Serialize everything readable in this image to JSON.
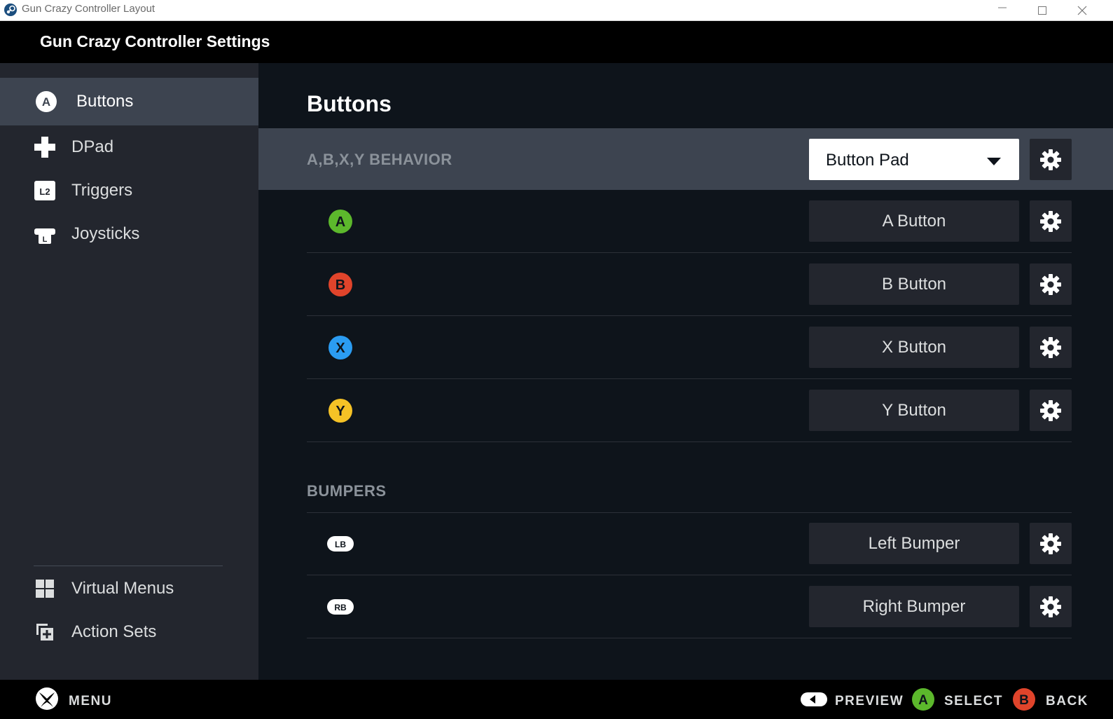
{
  "window": {
    "title": "Gun Crazy Controller Layout"
  },
  "app": {
    "title": "Gun Crazy Controller Settings"
  },
  "sidebar": {
    "items": [
      {
        "label": "Buttons",
        "icon": "a-button-icon",
        "active": true
      },
      {
        "label": "DPad",
        "icon": "dpad-icon",
        "active": false
      },
      {
        "label": "Triggers",
        "icon": "l2-trigger-icon",
        "active": false
      },
      {
        "label": "Joysticks",
        "icon": "joystick-icon",
        "active": false
      }
    ],
    "bottom_items": [
      {
        "label": "Virtual Menus",
        "icon": "virtual-menus-icon"
      },
      {
        "label": "Action Sets",
        "icon": "action-sets-icon"
      }
    ]
  },
  "main": {
    "heading": "Buttons",
    "behavior": {
      "label": "A,B,X,Y BEHAVIOR",
      "selected": "Button Pad"
    },
    "face_buttons": [
      {
        "glyph": "A",
        "color": "#5cb82c",
        "action": "A Button"
      },
      {
        "glyph": "B",
        "color": "#e0442b",
        "action": "B Button"
      },
      {
        "glyph": "X",
        "color": "#2b9cf2",
        "action": "X Button"
      },
      {
        "glyph": "Y",
        "color": "#f5c226",
        "action": "Y Button"
      }
    ],
    "bumpers_label": "BUMPERS",
    "bumpers": [
      {
        "glyph": "LB",
        "action": "Left Bumper"
      },
      {
        "glyph": "RB",
        "action": "Right Bumper"
      }
    ]
  },
  "footer": {
    "menu": "MENU",
    "preview": "PREVIEW",
    "select_glyph": "A",
    "select": "SELECT",
    "back_glyph": "B",
    "back": "BACK"
  },
  "colors": {
    "background": "#0e141b",
    "sidebar": "#23262e",
    "active": "#3d4450",
    "a_green": "#5cb82c",
    "b_red": "#e0442b",
    "x_blue": "#2b9cf2",
    "y_yellow": "#f5c226"
  }
}
